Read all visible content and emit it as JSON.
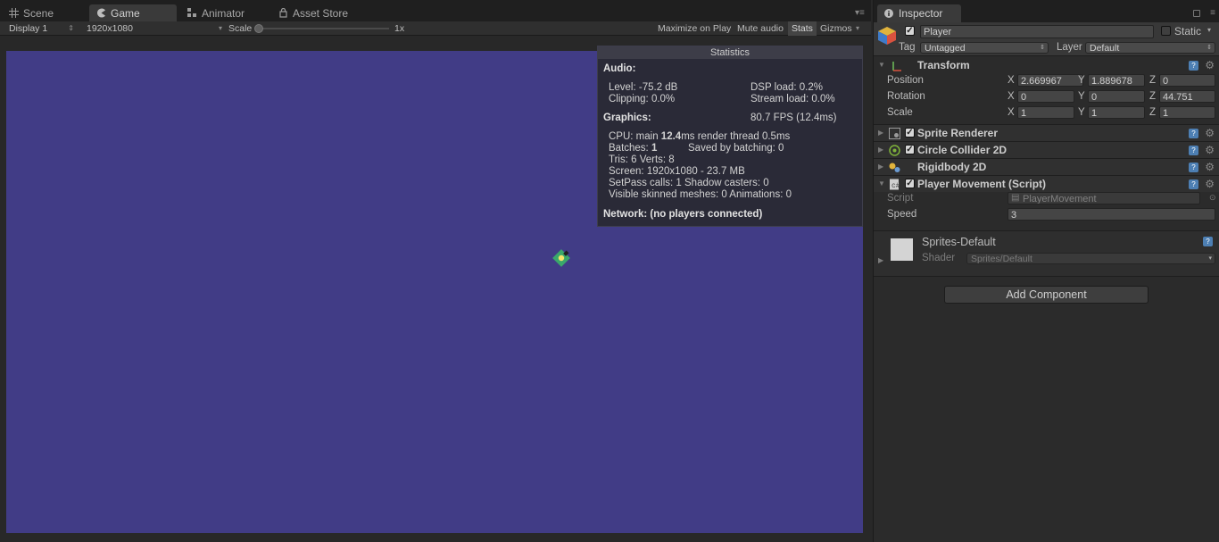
{
  "game_tabs": [
    {
      "label": "Scene",
      "icon": "scene-grid-icon"
    },
    {
      "label": "Game",
      "icon": "pacman-icon"
    },
    {
      "label": "Animator",
      "icon": "animator-icon"
    },
    {
      "label": "Asset Store",
      "icon": "store-icon"
    }
  ],
  "toolbar": {
    "display": "Display 1",
    "resolution": "1920x1080",
    "scale_label": "Scale",
    "scale_value": "1x",
    "maximize": "Maximize on Play",
    "mute": "Mute audio",
    "stats": "Stats",
    "gizmos": "Gizmos"
  },
  "viewport": {
    "background": "#413c86"
  },
  "statistics": {
    "title": "Statistics",
    "audio_header": "Audio:",
    "level": "Level: -75.2 dB",
    "clipping": "Clipping: 0.0%",
    "dsp": "DSP load: 0.2%",
    "stream": "Stream load: 0.0%",
    "graphics_header": "Graphics:",
    "fps": "80.7 FPS (12.4ms)",
    "cpu_prefix": "CPU: main ",
    "cpu_main": "12.4",
    "cpu_suffix": "ms  render thread 0.5ms",
    "batches_prefix": "Batches: ",
    "batches": "1",
    "saved": "Saved by batching: 0",
    "tris": "Tris: 6   Verts: 8",
    "screen": "Screen: 1920x1080 - 23.7 MB",
    "setpass": "SetPass calls: 1   Shadow casters: 0",
    "skinned": "Visible skinned meshes: 0  Animations: 0",
    "network": "Network: (no players connected)"
  },
  "inspector": {
    "tab": "Inspector",
    "object_name": "Player",
    "static_label": "Static",
    "tag_label": "Tag",
    "tag_value": "Untagged",
    "layer_label": "Layer",
    "layer_value": "Default",
    "transform": {
      "title": "Transform",
      "position_label": "Position",
      "rotation_label": "Rotation",
      "scale_label": "Scale",
      "position": {
        "x": "2.669967",
        "y": "1.889678",
        "z": "0"
      },
      "rotation": {
        "x": "0",
        "y": "0",
        "z": "44.751"
      },
      "scale": {
        "x": "1",
        "y": "1",
        "z": "1"
      }
    },
    "components": [
      {
        "title": "Sprite Renderer"
      },
      {
        "title": "Circle Collider 2D"
      },
      {
        "title": "Rigidbody 2D"
      },
      {
        "title": "Player Movement (Script)"
      }
    ],
    "script_label": "Script",
    "script_value": "PlayerMovement",
    "speed_label": "Speed",
    "speed_value": "3",
    "material": {
      "name": "Sprites-Default",
      "shader_label": "Shader",
      "shader_value": "Sprites/Default"
    },
    "add_component": "Add Component"
  }
}
